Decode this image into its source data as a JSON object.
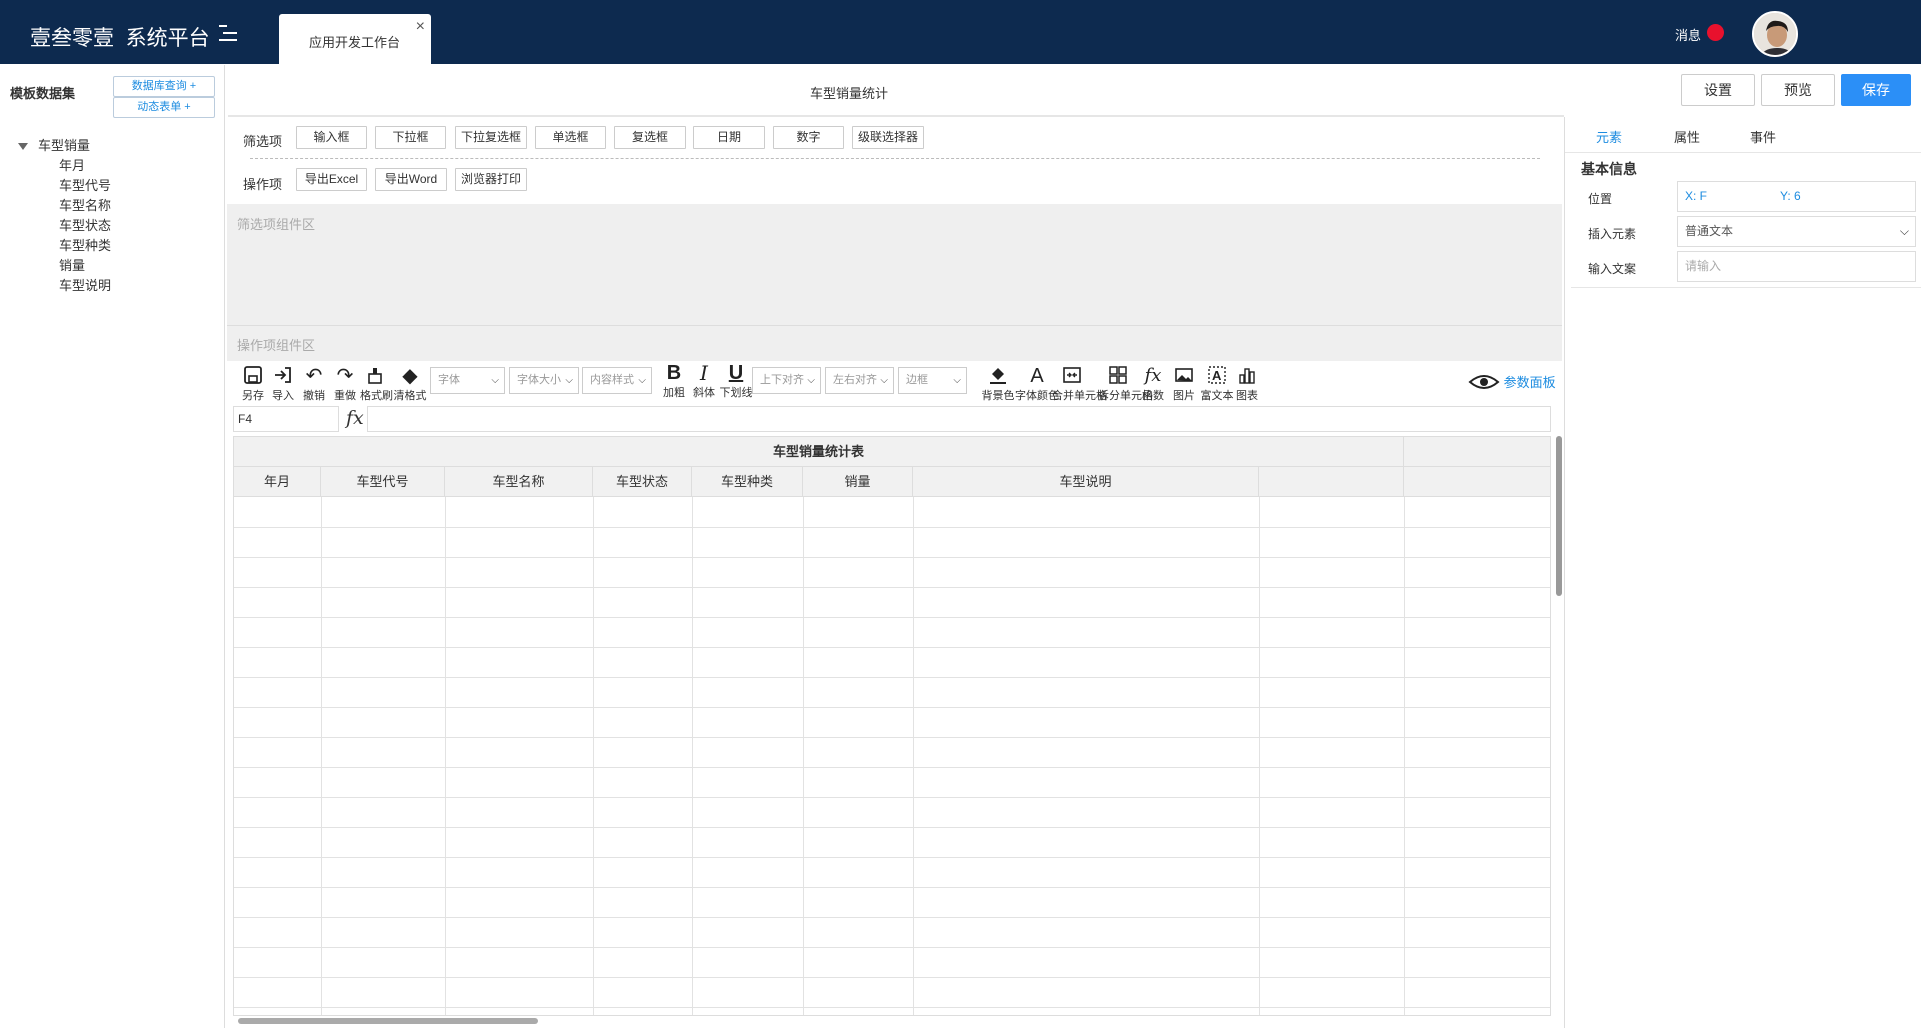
{
  "header": {
    "app_name": "壹叁零壹",
    "platform_name": "系统平台",
    "tab_label": "应用开发工作台",
    "tab_close": "×",
    "message_label": "消息"
  },
  "left_panel": {
    "title": "模板数据集",
    "db_query_button": "数据库查询 +",
    "dynamic_form_button": "动态表单 +",
    "tree": {
      "root": "车型销量",
      "children": [
        "年月",
        "车型代号",
        "车型名称",
        "车型状态",
        "车型种类",
        "销量",
        "车型说明"
      ]
    }
  },
  "center": {
    "title": "车型销量统计",
    "filter_label": "筛选项",
    "filter_buttons": [
      "输入框",
      "下拉框",
      "下拉复选框",
      "单选框",
      "复选框",
      "日期",
      "数字",
      "级联选择器"
    ],
    "action_label": "操作项",
    "action_buttons": [
      "导出Excel",
      "导出Word",
      "浏览器打印"
    ],
    "filter_zone_label": "筛选项组件区",
    "action_zone_label": "操作项组件区"
  },
  "top_right_buttons": {
    "settings": "设置",
    "preview": "预览",
    "save": "保存"
  },
  "toolbar": {
    "save_as": "另存",
    "import": "导入",
    "undo": "撤销",
    "redo": "重做",
    "format_brush": "格式刷",
    "clear_format": "清格式",
    "font_placeholder": "字体",
    "font_size_placeholder": "字体大小",
    "content_style_placeholder": "内容样式",
    "bold": "加粗",
    "italic": "斜体",
    "underline": "下划线",
    "valign_placeholder": "上下对齐",
    "halign_placeholder": "左右对齐",
    "border_placeholder": "边框",
    "bg_color": "背景色",
    "font_color": "字体颜色",
    "merge_cells": "合并单元格",
    "split_cells": "拆分单元格",
    "function": "函数",
    "image": "图片",
    "rich_text": "富文本",
    "chart": "图表",
    "param_panel": "参数面板"
  },
  "formula_bar": {
    "cell_ref": "F4",
    "fx_label": "fx",
    "formula_value": ""
  },
  "sheet": {
    "table_title": "车型销量统计表",
    "columns": [
      "年月",
      "车型代号",
      "车型名称",
      "车型状态",
      "车型种类",
      "销量",
      "车型说明"
    ]
  },
  "right_panel": {
    "tabs": [
      "元素",
      "属性",
      "事件"
    ],
    "active_tab": "元素",
    "section_title": "基本信息",
    "position_label": "位置",
    "position_x": "X:  F",
    "position_y": "Y:  6",
    "insert_element_label": "插入元素",
    "insert_element_value": "普通文本",
    "input_text_label": "输入文案",
    "input_text_placeholder": "请输入"
  },
  "colors": {
    "header_bg": "#0d2a4f",
    "accent": "#2b8ff7",
    "link": "#1d8ce0",
    "notification_dot": "#e8112d"
  }
}
